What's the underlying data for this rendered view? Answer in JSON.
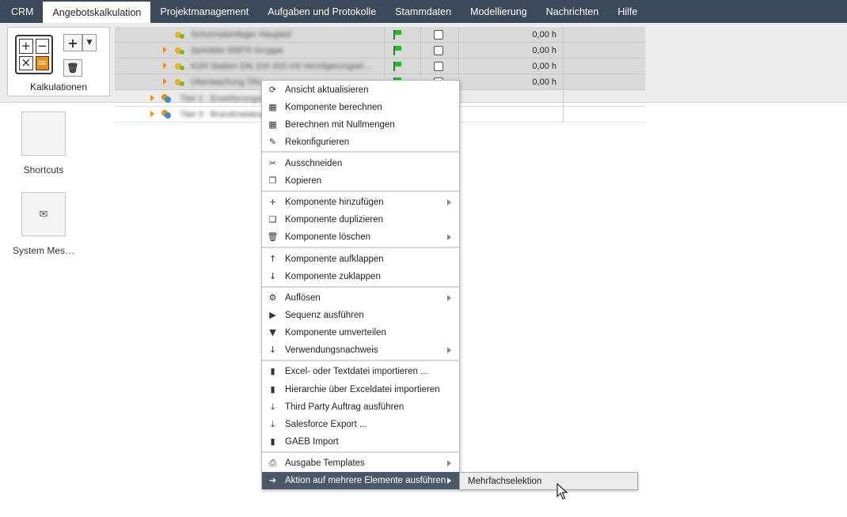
{
  "topnav": {
    "tabs": [
      "CRM",
      "Angebotskalkulation",
      "Projektmanagement",
      "Aufgaben und Protokolle",
      "Stammdaten",
      "Modellierung",
      "Nachrichten",
      "Hilfe"
    ]
  },
  "ribbon": {
    "kalkulationen_label": "Kalkulationen"
  },
  "shortcuts": {
    "shortcuts_label": "Shortcuts",
    "system_messages_label": "System Mes…"
  },
  "tree": {
    "rows": [
      {
        "label": "Schornsteinfeger Haupteil",
        "value": "0,00 h"
      },
      {
        "label": "Sprinkler 65870 Gruppe",
        "value": "0,00 h"
      },
      {
        "label": "Kühl Station DN 100 333 mit Verzögerungsel…",
        "value": "0,00 h"
      },
      {
        "label": "Überwachung TAV",
        "value": "0,00 h"
      },
      {
        "label": "Titel 2 : Erweiterungsbau",
        "value": ""
      },
      {
        "label": "Titel 3 : Brandmeldeanl",
        "value": ""
      }
    ]
  },
  "context_menu": {
    "items": [
      {
        "label": "Ansicht aktualisieren",
        "icon": "refresh-icon"
      },
      {
        "label": "Komponente berechnen",
        "icon": "calculator-icon"
      },
      {
        "label": "Berechnen mit Nullmengen",
        "icon": "calculator-icon"
      },
      {
        "label": "Rekonfigurieren",
        "icon": "magic-wand-icon"
      },
      {
        "label": "Ausschneiden",
        "icon": "scissors-icon"
      },
      {
        "label": "Kopieren",
        "icon": "copy-icon"
      },
      {
        "label": "Komponente hinzufügen",
        "icon": "plus-icon"
      },
      {
        "label": "Komponente duplizieren",
        "icon": "duplicate-icon"
      },
      {
        "label": "Komponente löschen",
        "icon": "trash-icon"
      },
      {
        "label": "Komponente aufklappen",
        "icon": "expand-icon"
      },
      {
        "label": "Komponente zuklappen",
        "icon": "collapse-icon"
      },
      {
        "label": "Auflösen",
        "icon": "gear-icon"
      },
      {
        "label": "Sequenz ausführen",
        "icon": "play-icon"
      },
      {
        "label": "Komponente umverteilen",
        "icon": "filter-icon"
      },
      {
        "label": "Verwendungsnachweis",
        "icon": "arrow-down-icon"
      },
      {
        "label": "Excel- oder Textdatei importieren ...",
        "icon": "file-icon"
      },
      {
        "label": "Hierarchie über Exceldatei importieren",
        "icon": "file-icon"
      },
      {
        "label": "Third Party Auftrag ausführen",
        "icon": "download-icon"
      },
      {
        "label": "Salesforce Export ...",
        "icon": "download-icon"
      },
      {
        "label": "GAEB Import",
        "icon": "file-icon"
      },
      {
        "label": "Ausgabe Templates",
        "icon": "print-icon"
      },
      {
        "label": "Aktion auf mehrere Elemente ausführen",
        "icon": "sign-in-icon"
      }
    ]
  },
  "submenu": {
    "label": "Mehrfachselektion"
  }
}
